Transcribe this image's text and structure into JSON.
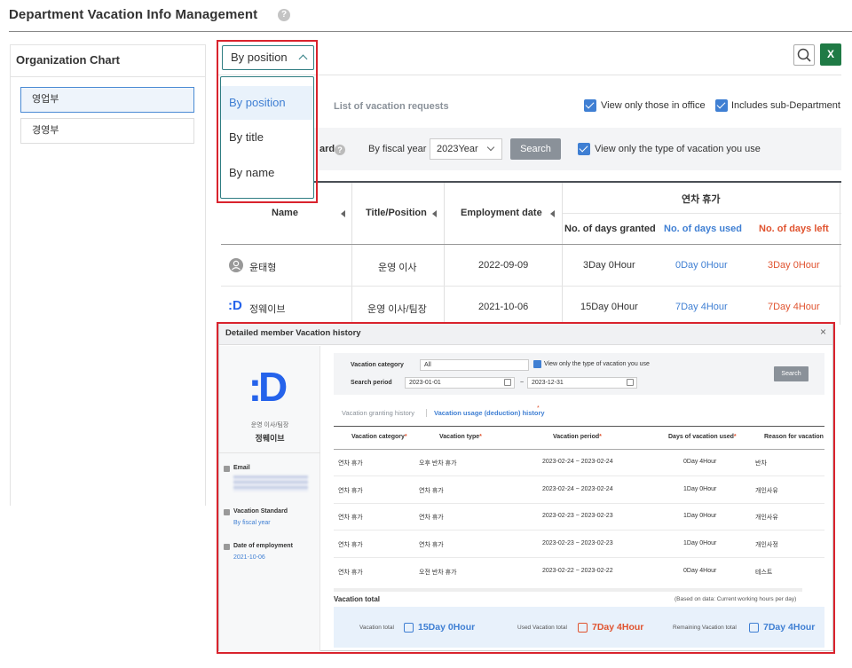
{
  "header": {
    "title": "Department Vacation Info Management",
    "help_glyph": "?"
  },
  "org": {
    "title": "Organization Chart",
    "items": [
      {
        "label": "영업부"
      },
      {
        "label": "경영부"
      }
    ]
  },
  "toolbar": {
    "sort_value": "By position",
    "sort_options": [
      "By position",
      "By title",
      "By name"
    ],
    "list_requests": "List of vacation requests",
    "view_only_office": "View only those in office",
    "includes_sub": "Includes sub-Department",
    "excel_label": "X"
  },
  "filter": {
    "standard_label": "ard",
    "fiscal_label": "By fiscal year",
    "year_value": "2023Year",
    "search_label": "Search",
    "view_type_label": "View only the type of vacation you use"
  },
  "table": {
    "group_header": "연차 휴가",
    "headers": {
      "name": "Name",
      "title": "Title/Position",
      "employment": "Employment date",
      "granted": "No. of days granted",
      "used": "No. of days used",
      "left": "No. of days left"
    },
    "rows": [
      {
        "name": "윤태형",
        "title": "운영 이사",
        "date": "2022-09-09",
        "granted": "3Day 0Hour",
        "used": "0Day 0Hour",
        "left": "3Day 0Hour",
        "avatar": "user-icon"
      },
      {
        "name": "정웨이브",
        "title": "운영 이사/팀장",
        "date": "2021-10-06",
        "granted": "15Day 0Hour",
        "used": "7Day 4Hour",
        "left": "7Day 4Hour",
        "avatar": ":D"
      }
    ]
  },
  "modal": {
    "title": "Detailed member Vacation history",
    "close": "×",
    "avatar": ":D",
    "role": "운영 이사/팀장",
    "name": "정웨이브",
    "email_label": "Email",
    "std_label": "Vacation Standard",
    "std_value": "By fiscal year",
    "emp_label": "Date of employment",
    "emp_value": "2021-10-06",
    "filter": {
      "category_label": "Vacation category",
      "category_value": "All",
      "view_type": "View only the type of vacation you use",
      "period_label": "Search period",
      "start": "2023-01-01",
      "tilde": "~",
      "end": "2023-12-31",
      "search": "Search"
    },
    "tabs": [
      "Vacation granting history",
      "Vacation usage (deduction) history"
    ],
    "headers": [
      "Vacation category",
      "Vacation type",
      "Vacation period",
      "Days of vacation used",
      "Reason for vacation"
    ],
    "rows": [
      {
        "cat": "연차 휴가",
        "type": "오후 반차 휴가",
        "period": "2023-02-24 ~ 2023-02-24",
        "days": "0Day 4Hour",
        "reason": "반차"
      },
      {
        "cat": "연차 휴가",
        "type": "연차 휴가",
        "period": "2023-02-24 ~ 2023-02-24",
        "days": "1Day 0Hour",
        "reason": "개인사유"
      },
      {
        "cat": "연차 휴가",
        "type": "연차 휴가",
        "period": "2023-02-23 ~ 2023-02-23",
        "days": "1Day 0Hour",
        "reason": "개인사유"
      },
      {
        "cat": "연차 휴가",
        "type": "연차 휴가",
        "period": "2023-02-23 ~ 2023-02-23",
        "days": "1Day 0Hour",
        "reason": "개인사정"
      },
      {
        "cat": "연차 휴가",
        "type": "오전 반차 휴가",
        "period": "2023-02-22 ~ 2023-02-22",
        "days": "0Day 4Hour",
        "reason": "테스트"
      }
    ],
    "total": {
      "title": "Vacation total",
      "note": "(Based on data: Current working hours per day)",
      "vac_label": "Vacation total",
      "vac_value": "15Day 0Hour",
      "used_label": "Used Vacation total",
      "used_value": "7Day 4Hour",
      "rem_label": "Remaining Vacation total",
      "rem_value": "7Day 4Hour"
    }
  },
  "colors": {
    "accent": "#3f7fd3",
    "danger": "#e0532f",
    "highlight": "#d9232d",
    "excel": "#1f7a45"
  }
}
